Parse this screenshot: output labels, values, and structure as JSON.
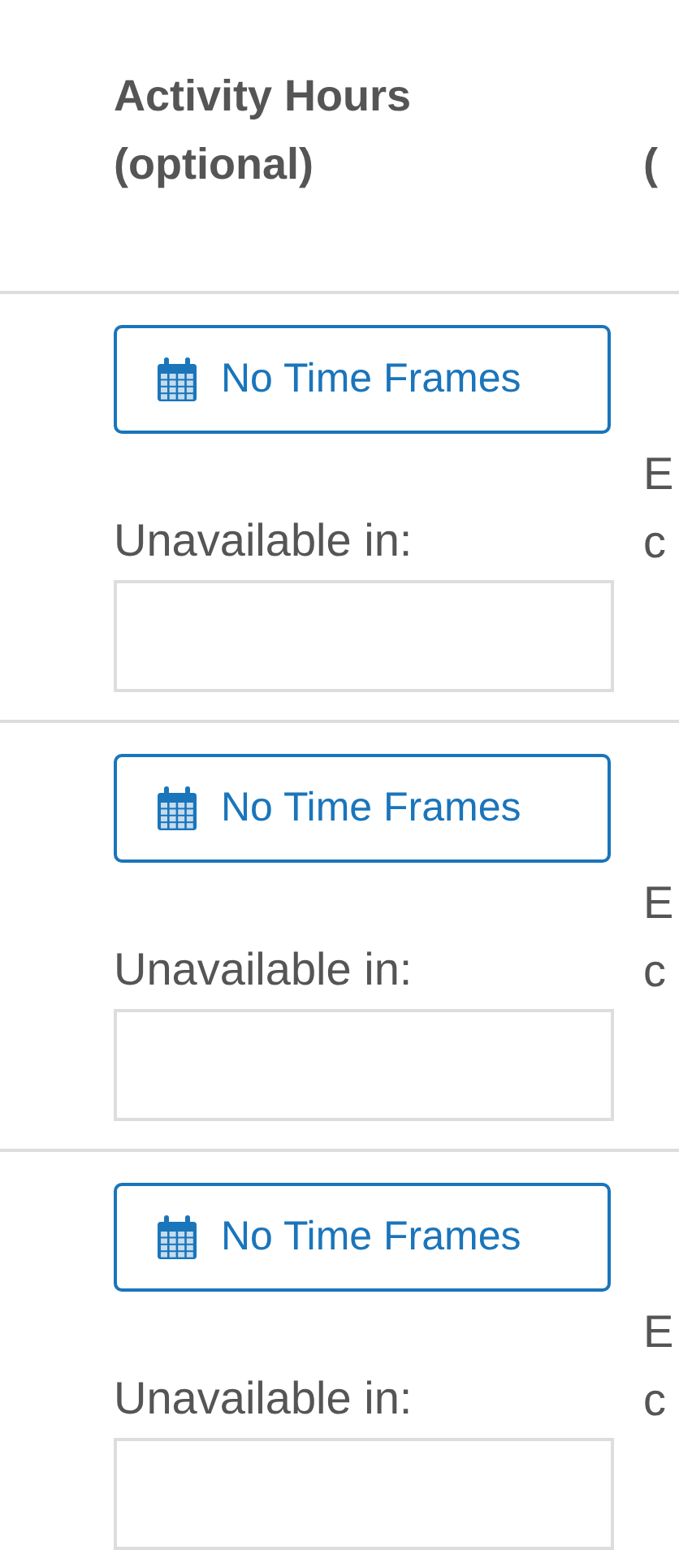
{
  "table": {
    "columns": [
      {
        "lines": [
          "Activity Hours",
          "(optional)"
        ]
      },
      {
        "lines": [
          "("
        ]
      }
    ],
    "rows": [
      {
        "button": "No Time Frames",
        "label": "Unavailable in:",
        "column_2": [
          "E",
          "c"
        ]
      },
      {
        "button": "No Time Frames",
        "label": "Unavailable in:",
        "column_2": [
          "E",
          "c"
        ]
      },
      {
        "button": "No Time Frames",
        "label": "Unavailable in:",
        "column_2": [
          "E",
          "c"
        ]
      }
    ]
  }
}
